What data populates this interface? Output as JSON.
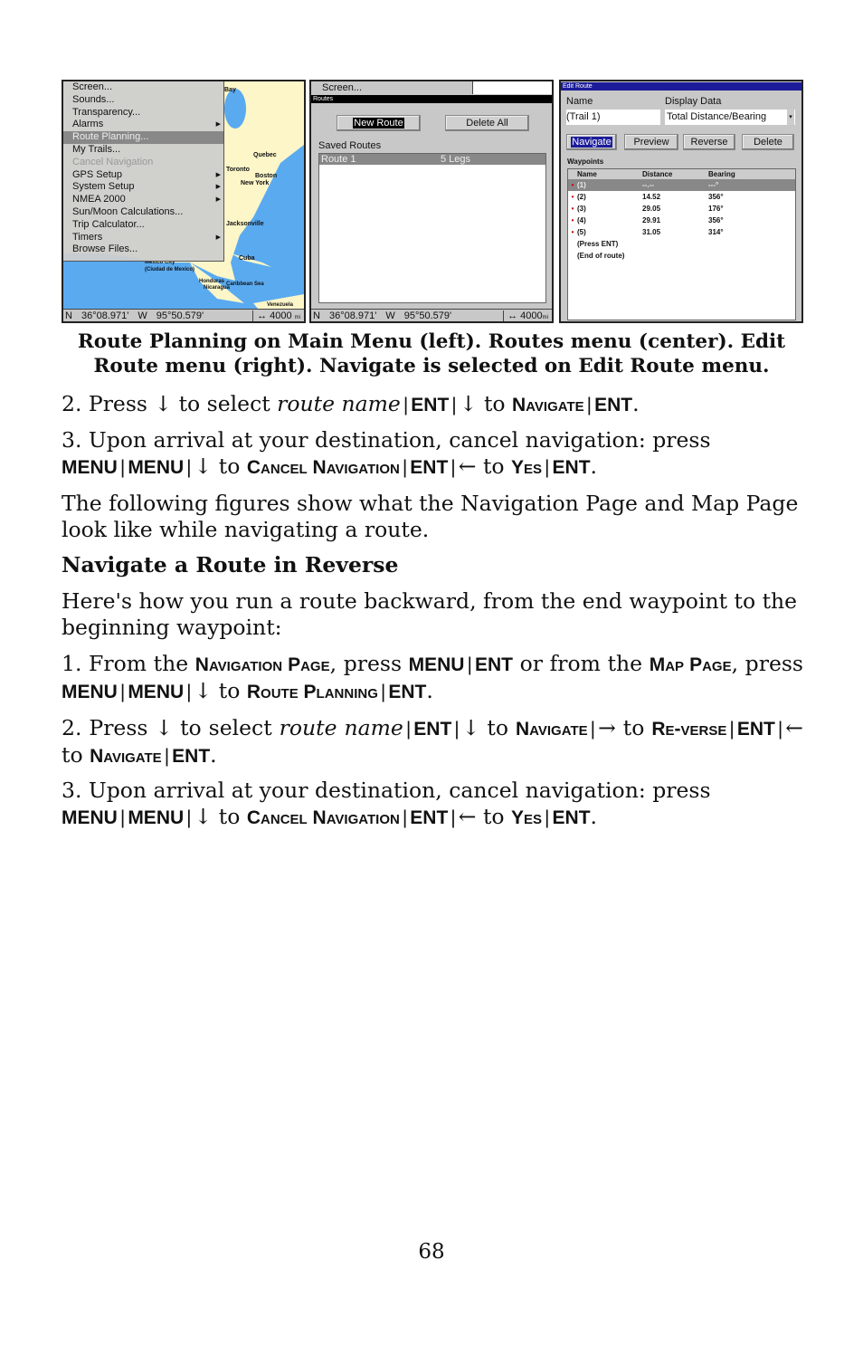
{
  "screens": {
    "main_menu": {
      "items": [
        {
          "label": "Screen..."
        },
        {
          "label": "Sounds..."
        },
        {
          "label": "Transparency..."
        },
        {
          "label": "Alarms",
          "submenu": true
        },
        {
          "label": "Route Planning...",
          "selected": true
        },
        {
          "label": "My Trails..."
        },
        {
          "label": "Cancel Navigation",
          "disabled": true
        },
        {
          "label": "GPS Setup",
          "submenu": true
        },
        {
          "label": "System Setup",
          "submenu": true
        },
        {
          "label": "NMEA 2000",
          "submenu": true
        },
        {
          "label": "Sun/Moon Calculations..."
        },
        {
          "label": "Trip Calculator..."
        },
        {
          "label": "Timers",
          "submenu": true
        },
        {
          "label": "Browse Files..."
        }
      ],
      "map_labels": [
        "Bay",
        "Quebec",
        "Toronto",
        "Boston",
        "New York",
        "Jacksonville",
        "Cuba",
        "Mexico City",
        "(Ciudad de Mexico)",
        "Honduras",
        "Nicaragua",
        "Caribbean Sea",
        "Venezuela"
      ],
      "status": {
        "lat_hemi": "N",
        "lat": "36°08.971'",
        "lon_hemi": "W",
        "lon": "95°50.579'",
        "scale": "↔ 4000",
        "scale_unit": "mi"
      }
    },
    "routes": {
      "menu_stub": "Screen...",
      "title": "Routes",
      "new_route": "New Route",
      "delete_all": "Delete All",
      "saved_label": "Saved Routes",
      "rows": [
        {
          "name": "Route 1",
          "legs": "5 Legs"
        }
      ],
      "status": {
        "lat_hemi": "N",
        "lat": "36°08.971'",
        "lon_hemi": "W",
        "lon": "95°50.579'",
        "scale": "↔ 4000",
        "scale_unit": "mi"
      }
    },
    "edit_route": {
      "title": "Edit Route",
      "name_label": "Name",
      "name_value": "(Trail 1)",
      "display_label": "Display Data",
      "display_value": "Total Distance/Bearing",
      "buttons": [
        "Navigate",
        "Preview",
        "Reverse",
        "Delete"
      ],
      "waypoints_label": "Waypoints",
      "columns": [
        "Name",
        "Distance",
        "Bearing"
      ],
      "rows": [
        {
          "name": "(1)",
          "distance": "--.--",
          "bearing": "---°"
        },
        {
          "name": "(2)",
          "distance": "14.52",
          "bearing": "356°"
        },
        {
          "name": "(3)",
          "distance": "29.05",
          "bearing": "176°"
        },
        {
          "name": "(4)",
          "distance": "29.91",
          "bearing": "356°"
        },
        {
          "name": "(5)",
          "distance": "31.05",
          "bearing": "314°"
        }
      ],
      "footer": [
        "(Press ENT)",
        "(End of route)"
      ],
      "colors": {
        "title_bar": "#1c1c9a",
        "selected": "#1c1c9a"
      }
    }
  },
  "caption": "Route Planning on Main Menu (left). Routes menu (center). Edit Route menu (right). Navigate is selected on Edit Route menu.",
  "paragraphs": [
    [
      {
        "s": "n",
        "t": "2. Press "
      },
      {
        "s": "n",
        "t": "↓"
      },
      {
        "s": "n",
        "t": " to select "
      },
      {
        "s": "i",
        "t": "route name"
      },
      {
        "s": "sep",
        "t": "|"
      },
      {
        "s": "k",
        "t": "ENT"
      },
      {
        "s": "sep",
        "t": "|"
      },
      {
        "s": "n",
        "t": "↓"
      },
      {
        "s": "n",
        "t": " to "
      },
      {
        "s": "sc",
        "t": "Navigate"
      },
      {
        "s": "sep",
        "t": "|"
      },
      {
        "s": "k",
        "t": "ENT"
      },
      {
        "s": "n",
        "t": "."
      }
    ],
    [
      {
        "s": "n",
        "t": "3. Upon arrival at your destination, cancel navigation: press "
      },
      {
        "s": "k",
        "t": "MENU"
      },
      {
        "s": "sep",
        "t": "|"
      },
      {
        "s": "k",
        "t": "MENU"
      },
      {
        "s": "sep",
        "t": "|"
      },
      {
        "s": "n",
        "t": "↓"
      },
      {
        "s": "n",
        "t": " to "
      },
      {
        "s": "sc",
        "t": "Cancel Navigation"
      },
      {
        "s": "sep",
        "t": "|"
      },
      {
        "s": "k",
        "t": "ENT"
      },
      {
        "s": "sep",
        "t": "|"
      },
      {
        "s": "n",
        "t": "←"
      },
      {
        "s": "n",
        "t": " to "
      },
      {
        "s": "sc",
        "t": "Yes"
      },
      {
        "s": "sep",
        "t": "|"
      },
      {
        "s": "k",
        "t": "ENT"
      },
      {
        "s": "n",
        "t": "."
      }
    ],
    [
      {
        "s": "n",
        "t": "The following figures show what the Navigation Page and Map Page look like while navigating a route."
      }
    ],
    [
      {
        "s": "h",
        "t": "Navigate a Route in Reverse"
      }
    ],
    [
      {
        "s": "n",
        "t": "Here's how you run a route backward, from the end waypoint to the beginning waypoint:"
      }
    ],
    [
      {
        "s": "n",
        "t": "1. From the "
      },
      {
        "s": "sc",
        "t": "Navigation Page"
      },
      {
        "s": "n",
        "t": ", press "
      },
      {
        "s": "k",
        "t": "MENU"
      },
      {
        "s": "sep",
        "t": "|"
      },
      {
        "s": "k",
        "t": "ENT"
      },
      {
        "s": "n",
        "t": " or from the "
      },
      {
        "s": "sc",
        "t": "Map Page"
      },
      {
        "s": "n",
        "t": ", press "
      },
      {
        "s": "k",
        "t": "MENU"
      },
      {
        "s": "sep",
        "t": "|"
      },
      {
        "s": "k",
        "t": "MENU"
      },
      {
        "s": "sep",
        "t": "|"
      },
      {
        "s": "n",
        "t": "↓"
      },
      {
        "s": "n",
        "t": " to "
      },
      {
        "s": "sc",
        "t": "Route Planning"
      },
      {
        "s": "sep",
        "t": "|"
      },
      {
        "s": "k",
        "t": "ENT"
      },
      {
        "s": "n",
        "t": "."
      }
    ],
    [
      {
        "s": "n",
        "t": "2. Press ↓ to select "
      },
      {
        "s": "i",
        "t": "route name"
      },
      {
        "s": "sep",
        "t": "|"
      },
      {
        "s": "k",
        "t": "ENT"
      },
      {
        "s": "sep",
        "t": "|"
      },
      {
        "s": "n",
        "t": "↓"
      },
      {
        "s": "n",
        "t": " to "
      },
      {
        "s": "sc",
        "t": "Navigate"
      },
      {
        "s": "sep",
        "t": "|"
      },
      {
        "s": "n",
        "t": "→"
      },
      {
        "s": "n",
        "t": " to "
      },
      {
        "s": "sc",
        "t": "Re-verse"
      },
      {
        "s": "sep",
        "t": "|"
      },
      {
        "s": "k",
        "t": "ENT"
      },
      {
        "s": "sep",
        "t": "|"
      },
      {
        "s": "n",
        "t": "←"
      },
      {
        "s": "n",
        "t": " to "
      },
      {
        "s": "sc",
        "t": "Navigate"
      },
      {
        "s": "sep",
        "t": "|"
      },
      {
        "s": "k",
        "t": "ENT"
      },
      {
        "s": "n",
        "t": "."
      }
    ],
    [
      {
        "s": "n",
        "t": "3. Upon arrival at your destination, cancel navigation: press "
      },
      {
        "s": "k",
        "t": "MENU"
      },
      {
        "s": "sep",
        "t": "|"
      },
      {
        "s": "k",
        "t": "MENU"
      },
      {
        "s": "sep",
        "t": "|"
      },
      {
        "s": "n",
        "t": "↓"
      },
      {
        "s": "n",
        "t": " to "
      },
      {
        "s": "sc",
        "t": "Cancel Navigation"
      },
      {
        "s": "sep",
        "t": "|"
      },
      {
        "s": "k",
        "t": "ENT"
      },
      {
        "s": "sep",
        "t": "|"
      },
      {
        "s": "n",
        "t": "←"
      },
      {
        "s": "n",
        "t": " to "
      },
      {
        "s": "sc",
        "t": "Yes"
      },
      {
        "s": "sep",
        "t": "|"
      },
      {
        "s": "k",
        "t": "ENT"
      },
      {
        "s": "n",
        "t": "."
      }
    ]
  ],
  "page_number": "68"
}
